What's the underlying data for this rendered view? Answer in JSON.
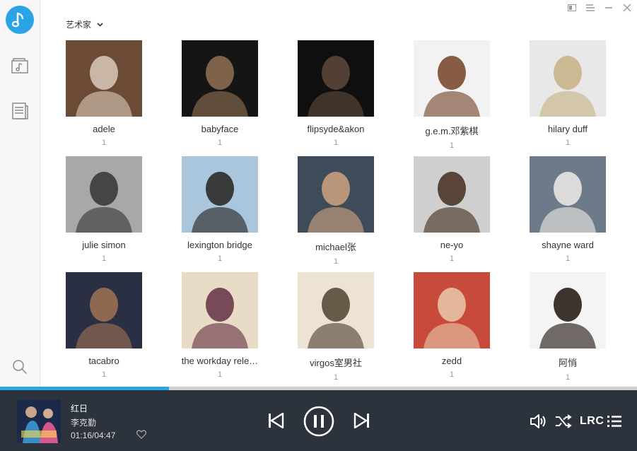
{
  "window": {
    "controls": [
      "mini-mode",
      "menu",
      "minimize",
      "close"
    ]
  },
  "sidebar": {
    "items": [
      {
        "icon": "music-note-icon"
      },
      {
        "icon": "music-folder-icon"
      },
      {
        "icon": "document-list-icon"
      },
      {
        "icon": "search-icon"
      }
    ]
  },
  "filter": {
    "label": "艺术家"
  },
  "artists": [
    {
      "name": "adele",
      "count": "1",
      "palette": [
        "#6b4a36",
        "#d5c2b2"
      ]
    },
    {
      "name": "babyface",
      "count": "1",
      "palette": [
        "#151515",
        "#8a6b50"
      ]
    },
    {
      "name": "flipsyde&akon",
      "count": "1",
      "palette": [
        "#0f0f0f",
        "#5a4638"
      ]
    },
    {
      "name": "g.e.m.邓紫棋",
      "count": "1",
      "palette": [
        "#f2f2f2",
        "#7a4b32"
      ]
    },
    {
      "name": "hilary duff",
      "count": "1",
      "palette": [
        "#e8e8e8",
        "#c9b38a"
      ]
    },
    {
      "name": "julie simon",
      "count": "1",
      "palette": [
        "#a8a8a8",
        "#3a3a3a"
      ]
    },
    {
      "name": "lexington bridge",
      "count": "1",
      "palette": [
        "#a9c6dc",
        "#2c2a28"
      ]
    },
    {
      "name": "michael张",
      "count": "1",
      "palette": [
        "#3e4b58",
        "#c79e7e"
      ]
    },
    {
      "name": "ne-yo",
      "count": "1",
      "palette": [
        "#cfcfcf",
        "#4a3527"
      ]
    },
    {
      "name": "shayne ward",
      "count": "1",
      "palette": [
        "#6c7a8a",
        "#e9e6e1"
      ]
    },
    {
      "name": "tacabro",
      "count": "1",
      "palette": [
        "#2a2f44",
        "#9a6f52"
      ]
    },
    {
      "name": "the workday rele…",
      "count": "1",
      "palette": [
        "#e9dcc6",
        "#6b3a4a"
      ]
    },
    {
      "name": "virgos室男社",
      "count": "1",
      "palette": [
        "#ece3d2",
        "#5a4a3a"
      ]
    },
    {
      "name": "zedd",
      "count": "1",
      "palette": [
        "#c84a3a",
        "#e7c2a5"
      ]
    },
    {
      "name": "阿悄",
      "count": "1",
      "palette": [
        "#f4f4f4",
        "#2a1f1a"
      ]
    }
  ],
  "player": {
    "title": "红日",
    "artist": "李克勤",
    "time": "01:16/04:47",
    "progress_fraction": 0.265,
    "lrc_label": "LRC",
    "accent": "#2aa4e6"
  }
}
